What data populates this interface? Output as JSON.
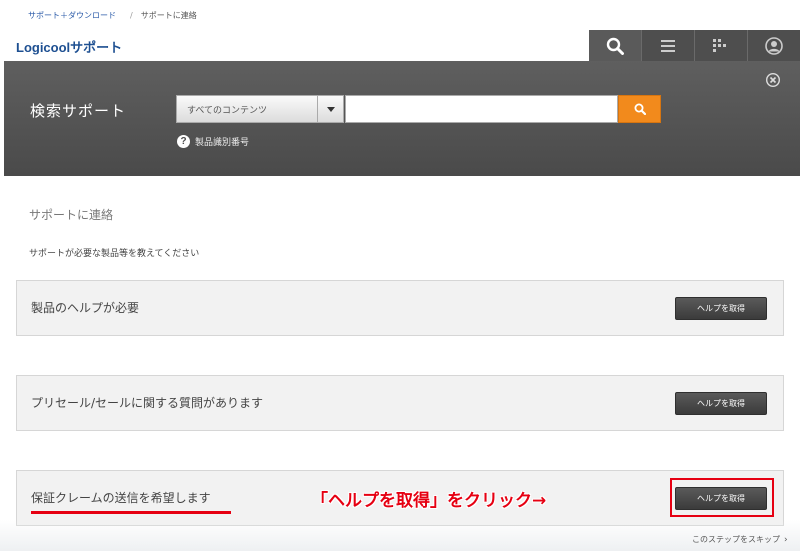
{
  "breadcrumb": {
    "home": "サポート＋ダウンロード",
    "separator": "/",
    "current": "サポートに連絡"
  },
  "brand": {
    "name": "Logicoolサポート"
  },
  "topnav": {
    "icons": [
      "search-icon",
      "menu-icon",
      "grid-icon",
      "user-icon"
    ]
  },
  "search_panel": {
    "title": "検索サポート",
    "select_value": "すべてのコンテンツ",
    "input_value": "",
    "product_id_link": "製品識別番号"
  },
  "section": {
    "title": "サポートに連絡",
    "subtitle": "サポートが必要な製品等を教えてください"
  },
  "cards": [
    {
      "label": "製品のヘルプが必要",
      "button": "ヘルプを取得"
    },
    {
      "label": "プリセール/セールに関する質問があります",
      "button": "ヘルプを取得"
    },
    {
      "label": "保証クレームの送信を希望します",
      "button": "ヘルプを取得"
    }
  ],
  "annotation": {
    "text": "「ヘルプを取得」をクリック→"
  },
  "skip": {
    "label": "このステップをスキップ"
  },
  "colors": {
    "accent_orange": "#f28a1c",
    "brand_blue": "#1d4f91",
    "annotation_red": "#e60012",
    "panel_gray": "#555555"
  }
}
